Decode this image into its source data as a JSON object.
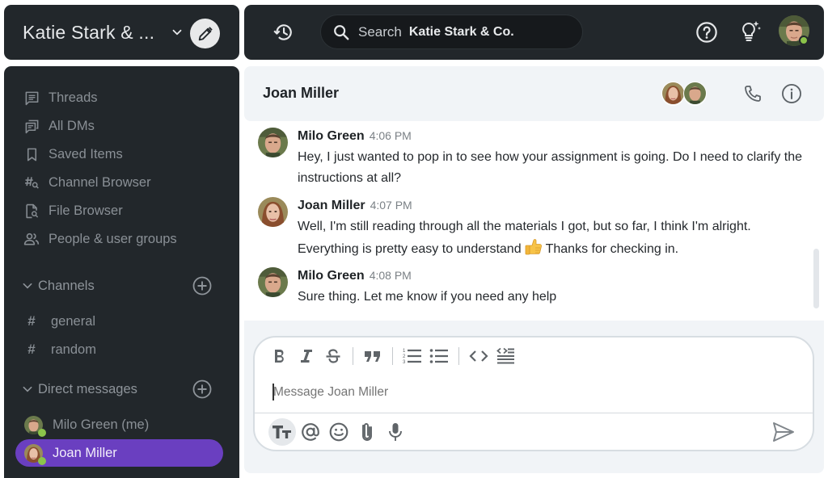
{
  "workspace": {
    "title": "Katie Stark & ...",
    "compose_icon": "pencil-icon",
    "switcher_icon": "chevron-down-icon"
  },
  "topbar": {
    "history_icon": "history-icon",
    "search": {
      "label": "Search",
      "scope": "Katie Stark & Co."
    },
    "help_icon": "help-circle-icon",
    "tips_icon": "lightbulb-sparkle-icon",
    "current_user_status": "online"
  },
  "sidebar": {
    "nav": [
      {
        "label": "Threads",
        "icon": "threads-icon"
      },
      {
        "label": "All DMs",
        "icon": "all-dms-icon"
      },
      {
        "label": "Saved Items",
        "icon": "bookmark-icon"
      },
      {
        "label": "Channel Browser",
        "icon": "channel-browser-icon"
      },
      {
        "label": "File Browser",
        "icon": "file-browser-icon"
      },
      {
        "label": "People & user groups",
        "icon": "people-icon"
      }
    ],
    "channels_section": {
      "label": "Channels",
      "items": [
        {
          "label": "general"
        },
        {
          "label": "random"
        }
      ]
    },
    "dm_section": {
      "label": "Direct messages",
      "items": [
        {
          "label": "Milo Green (me)",
          "status": "online",
          "active": false
        },
        {
          "label": "Joan Miller",
          "status": "online",
          "active": true
        }
      ]
    },
    "active_color": "#6a3fc0"
  },
  "chat": {
    "title": "Joan Miller",
    "participants": [
      "Joan Miller",
      "Milo Green"
    ],
    "call_icon": "phone-icon",
    "info_icon": "info-icon",
    "messages": [
      {
        "author": "Milo Green",
        "time": "4:06 PM",
        "text": "Hey, I just wanted to pop in to see how your assignment is going. Do I need to clarify the instructions at all?"
      },
      {
        "author": "Joan Miller",
        "time": "4:07 PM",
        "text_before": "Well, I'm still reading through all the materials I got, but so far, I think I'm alright. Everything is pretty easy to understand",
        "emoji": "thumbs-up",
        "text_after": "Thanks for checking in."
      },
      {
        "author": "Milo Green",
        "time": "4:08 PM",
        "text": "Sure thing. Let me know if you need any help"
      }
    ]
  },
  "composer": {
    "placeholder": "Message Joan Miller",
    "value": "",
    "format_tools": [
      "bold",
      "italic",
      "strikethrough",
      "quote",
      "ordered-list",
      "bulleted-list",
      "code",
      "code-block"
    ],
    "input_tools": [
      "text-format",
      "mention",
      "emoji",
      "attach",
      "microphone"
    ],
    "send_icon": "send-icon"
  }
}
